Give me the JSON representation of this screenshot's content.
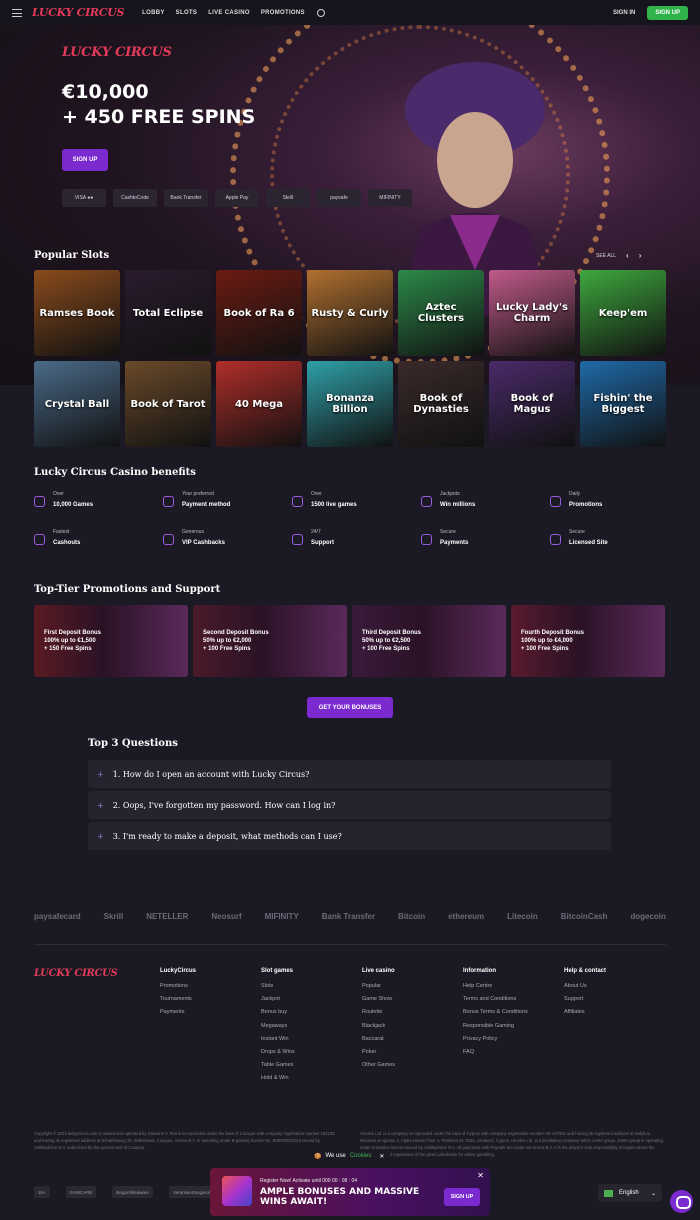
{
  "nav": {
    "logo": "LUCKY CIRCUS",
    "links": [
      "LOBBY",
      "SLOTS",
      "LIVE CASINO",
      "PROMOTIONS"
    ],
    "signin": "SIGN IN",
    "signup": "SIGN UP"
  },
  "hero": {
    "logo": "LUCKY CIRCUS",
    "headline1": "€10,000",
    "headline2": "+ 450 FREE SPINS",
    "cta": "SIGN UP",
    "payments": [
      "VISA ●●",
      "CashtoCode",
      "Bank Transfer",
      "Apple Pay",
      "Skrill",
      "paysafe",
      "MIFINITY"
    ]
  },
  "popular": {
    "title": "Popular Slots",
    "see_all": "SEE ALL",
    "prev": "‹",
    "next": "›",
    "tiles": [
      {
        "name": "Ramses Book",
        "color": "#8a4b1c"
      },
      {
        "name": "Total Eclipse",
        "color": "#2a1b2e"
      },
      {
        "name": "Book of Ra 6",
        "color": "#6b1b12"
      },
      {
        "name": "Rusty & Curly",
        "color": "#b07030"
      },
      {
        "name": "Aztec Clusters",
        "color": "#2c8a4a"
      },
      {
        "name": "Lucky Lady's Charm",
        "color": "#c05a8a"
      },
      {
        "name": "Keep'em",
        "color": "#3ea83e"
      },
      {
        "name": "Crystal Ball",
        "color": "#4a6a88"
      },
      {
        "name": "Book of Tarot",
        "color": "#6a4a2a"
      },
      {
        "name": "40 Mega",
        "color": "#b02e2a"
      },
      {
        "name": "Bonanza Billion",
        "color": "#2fa0a8"
      },
      {
        "name": "Book of Dynasties",
        "color": "#3a2a2a"
      },
      {
        "name": "Book of Magus",
        "color": "#4a2a6a"
      },
      {
        "name": "Fishin' the Biggest",
        "color": "#1f6aa8"
      }
    ]
  },
  "benefits": {
    "title": "Lucky Circus Casino benefits",
    "items": [
      {
        "top": "Over",
        "bottom": "10,000 Games"
      },
      {
        "top": "Your preferred",
        "bottom": "Payment method"
      },
      {
        "top": "Over",
        "bottom": "1500 live games"
      },
      {
        "top": "Jackpots",
        "bottom": "Win millions"
      },
      {
        "top": "Daily",
        "bottom": "Promotions"
      },
      {
        "top": "Fastest",
        "bottom": "Cashouts"
      },
      {
        "top": "Generous",
        "bottom": "VIP Cashbacks"
      },
      {
        "top": "24/7",
        "bottom": "Support"
      },
      {
        "top": "Secure",
        "bottom": "Payments"
      },
      {
        "top": "Secure",
        "bottom": "Licensed Site"
      }
    ]
  },
  "promos": {
    "title": "Top-Tier Promotions and Support",
    "cards": [
      {
        "name": "First Deposit Bonus",
        "line1": "100% up to €1,500",
        "line2": "+ 150 Free Spins",
        "color": "#5a1a22"
      },
      {
        "name": "Second Deposit Bonus",
        "line1": "50% up to €2,000",
        "line2": "+ 100 Free Spins",
        "color": "#4a1a2a"
      },
      {
        "name": "Third Deposit Bonus",
        "line1": "50% up to €2,500",
        "line2": "+ 100 Free Spins",
        "color": "#3a1a3a"
      },
      {
        "name": "Fourth Deposit Bonus",
        "line1": "100% up to €4,000",
        "line2": "+ 100 Free Spins",
        "color": "#5a1a2e"
      }
    ],
    "button": "GET YOUR BONUSES"
  },
  "faq": {
    "title": "Top 3 Questions",
    "items": [
      "1. How do I open an account with Lucky Circus?",
      "2. Oops, I've forgotten my password. How can I log in?",
      "3. I'm ready to make a deposit, what methods can I use?"
    ]
  },
  "payment_logos": [
    "paysafecard",
    "Skrill",
    "NETELLER",
    "Neosurf",
    "MIFINITY",
    "Bank Transfer",
    "Bitcoin",
    "ethereum",
    "Litecoin",
    "BitcoinCash",
    "dogecoin"
  ],
  "footer": {
    "logo": "LUCKY CIRCUS",
    "columns": [
      {
        "head": "LuckyCircus",
        "links": [
          "Promotions",
          "Tournaments",
          "Payments"
        ]
      },
      {
        "head": "Slot games",
        "links": [
          "Slots",
          "Jackpot",
          "Bonus buy",
          "Megaways",
          "Instant Win",
          "Drops & Wins",
          "Table Games",
          "Hold & Win"
        ]
      },
      {
        "head": "Live casino",
        "links": [
          "Popular",
          "Game Show",
          "Roulette",
          "Blackjack",
          "Baccarat",
          "Poker",
          "Other Games"
        ]
      },
      {
        "head": "Information",
        "links": [
          "Help Centre",
          "Terms and Conditions",
          "Bonus Terms & Conditions",
          "Responsible Gaming",
          "Privacy Policy",
          "FAQ"
        ]
      },
      {
        "head": "Help & contact",
        "links": [
          "About Us",
          "Support",
          "Affiliates"
        ]
      }
    ],
    "legal_left": "Copyright © 2024 luckycircus.com is owned and operated by Onesa B.V. that is incorporated under the laws of Curaçao with company registration number 162120 and having its registered address at Scharlooweg 39, Willemstad, Curaçao. Onesa B.V. is operating under B-gaming license No. B0000/00/2023 issued by Antillephone N.V. authorized by the government of Curaçao.",
    "legal_right": "Hinokio Ltd. is a company incorporated under the laws of Cyprus with company registration number HE 447652 and having its registered address at Nafpliou Nicolaou & Agiotou 3, Alpha House Floor 3, Partitioni St. 3035, Limassol, Cyprus. Hinokio Ltd. is a facilitating company within JAMA group. JAMA group is operating under B-gaming license issued by Antillephone N.V. All payments with Paysafe are made via Onesa B.V. It is the player's sole responsibility to inquire about the existing laws and regulations of the given jurisdiction for online gambling.",
    "badges": [
      "18+",
      "GAMCARE",
      "Begambleaware",
      "Verantwortungsvoll SPIELEN"
    ]
  },
  "cookie": {
    "emoji": "🍪",
    "text": "We use",
    "link": "Cookies",
    "close": "✕"
  },
  "banner": {
    "small": "Register Now!   Activate until  000 00 : 08 : 04",
    "big": "AMPLE BONUSES AND MASSIVE WINS AWAIT!",
    "button": "SIGN UP",
    "close": "✕"
  },
  "language": {
    "label": "English",
    "chevron": "⌄"
  }
}
